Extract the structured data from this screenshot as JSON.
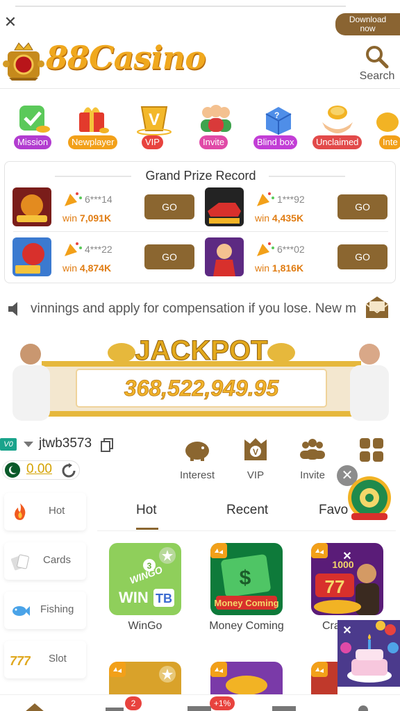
{
  "header": {
    "close_symbol": "✕",
    "download_label_line1": "Download",
    "download_label_line2": "now",
    "logo_text": "88Casino",
    "search_label": "Search"
  },
  "shortcuts": [
    {
      "label": "Mission",
      "color": "#b23cd0",
      "icon": "mission-icon"
    },
    {
      "label": "Newplayer",
      "color": "#f2a019",
      "icon": "gift-icon"
    },
    {
      "label": "VIP",
      "color": "#e8433e",
      "icon": "vip-icon"
    },
    {
      "label": "Invite",
      "color": "#e04aa7",
      "icon": "people-icon"
    },
    {
      "label": "Blind box",
      "color": "#c23ed6",
      "icon": "blind-box-icon"
    },
    {
      "label": "Unclaimed",
      "color": "#e24a4a",
      "icon": "coins-hand-icon"
    },
    {
      "label": "Inte",
      "color": "#f2a019",
      "icon": "interest-icon"
    }
  ],
  "grand_prize": {
    "title": "Grand Prize Record",
    "win_word": "win",
    "go_label": "GO",
    "records": [
      {
        "user": "6***14",
        "amount": "7,091K"
      },
      {
        "user": "1***92",
        "amount": "4,435K"
      },
      {
        "user": "4***22",
        "amount": "4,874K"
      },
      {
        "user": "6***02",
        "amount": "1,816K"
      }
    ]
  },
  "marquee": {
    "text": "vinnings and apply for compensation if you lose.   New m"
  },
  "jackpot": {
    "title": "JACKPOT",
    "amount": "368,522,949.95"
  },
  "user": {
    "vip_level": "V0",
    "username": "jtwb3573",
    "balance": "0.00"
  },
  "user_actions": [
    {
      "label": "Interest"
    },
    {
      "label": "VIP"
    },
    {
      "label": "Invite"
    }
  ],
  "dismiss_symbol": "✕",
  "categories": [
    {
      "label": "Hot"
    },
    {
      "label": "Cards"
    },
    {
      "label": "Fishing"
    },
    {
      "label": "Slot"
    }
  ],
  "tabs": [
    {
      "label": "Hot"
    },
    {
      "label": "Recent"
    },
    {
      "label": "Favo"
    }
  ],
  "games": [
    {
      "label": "WinGo"
    },
    {
      "label": "Money Coming"
    },
    {
      "label": "Cra"
    }
  ],
  "bottom_nav": {
    "badge_count": "2",
    "bonus_badge": "+1%"
  },
  "colors": {
    "brand_brown": "#8b6630",
    "win_orange": "#e07c12",
    "logo_gold": "#f0a81e"
  }
}
